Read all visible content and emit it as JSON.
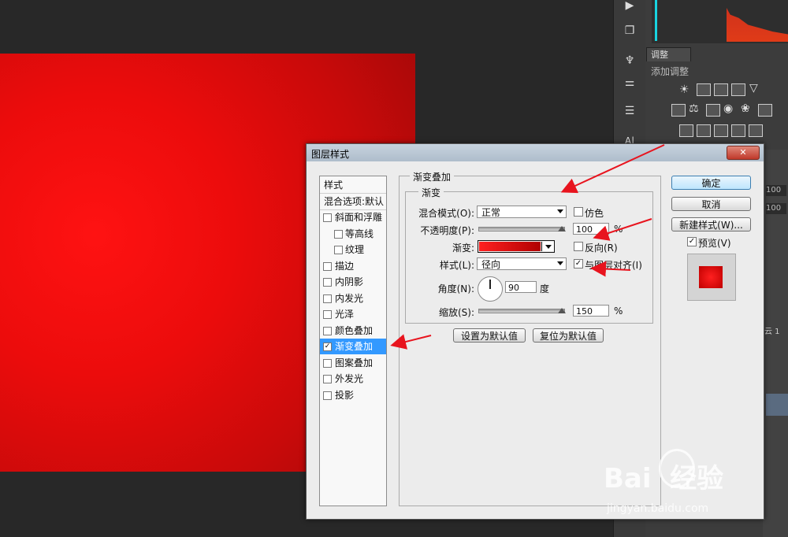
{
  "panel": {
    "adjust_tab": "调整",
    "add_adjustment": "添加调整",
    "layer_opacity_value": "100",
    "layer_fill_value": "100",
    "layer_name_fragment": "云 1"
  },
  "dialog": {
    "title": "图层样式",
    "close_glyph": "✕",
    "style_list": [
      {
        "label": "样式",
        "checkbox": false,
        "checked": false,
        "selected": false,
        "indent": false
      },
      {
        "label": "混合选项:默认",
        "checkbox": false,
        "checked": false,
        "selected": false,
        "indent": false
      },
      {
        "label": "斜面和浮雕",
        "checkbox": true,
        "checked": false,
        "selected": false,
        "indent": false
      },
      {
        "label": "等高线",
        "checkbox": true,
        "checked": false,
        "selected": false,
        "indent": true
      },
      {
        "label": "纹理",
        "checkbox": true,
        "checked": false,
        "selected": false,
        "indent": true
      },
      {
        "label": "描边",
        "checkbox": true,
        "checked": false,
        "selected": false,
        "indent": false
      },
      {
        "label": "内阴影",
        "checkbox": true,
        "checked": false,
        "selected": false,
        "indent": false
      },
      {
        "label": "内发光",
        "checkbox": true,
        "checked": false,
        "selected": false,
        "indent": false
      },
      {
        "label": "光泽",
        "checkbox": true,
        "checked": false,
        "selected": false,
        "indent": false
      },
      {
        "label": "颜色叠加",
        "checkbox": true,
        "checked": false,
        "selected": false,
        "indent": false
      },
      {
        "label": "渐变叠加",
        "checkbox": true,
        "checked": true,
        "selected": true,
        "indent": false
      },
      {
        "label": "图案叠加",
        "checkbox": true,
        "checked": false,
        "selected": false,
        "indent": false
      },
      {
        "label": "外发光",
        "checkbox": true,
        "checked": false,
        "selected": false,
        "indent": false
      },
      {
        "label": "投影",
        "checkbox": true,
        "checked": false,
        "selected": false,
        "indent": false
      }
    ],
    "group_title": "渐变叠加",
    "subgroup_title": "渐变",
    "blend_mode_label": "混合模式(O):",
    "blend_mode_value": "正常",
    "dither_label": "仿色",
    "dither_checked": false,
    "opacity_label": "不透明度(P):",
    "opacity_value": "100",
    "opacity_unit": "%",
    "gradient_label": "渐变:",
    "reverse_label": "反向(R)",
    "reverse_checked": false,
    "style_label": "样式(L):",
    "style_value": "径向",
    "align_label": "与图层对齐(I)",
    "align_checked": true,
    "angle_label": "角度(N):",
    "angle_value": "90",
    "angle_unit": "度",
    "scale_label": "缩放(S):",
    "scale_value": "150",
    "scale_unit": "%",
    "set_default_btn": "设置为默认值",
    "reset_default_btn": "复位为默认值",
    "ok_btn": "确定",
    "cancel_btn": "取消",
    "new_style_btn": "新建样式(W)...",
    "preview_label": "预览(V)",
    "preview_checked": true
  },
  "watermark": {
    "brand": "Bai  经验",
    "url": "jingyan.baidu.com"
  },
  "colors": {
    "canvas_red": "#ee0c0c",
    "selection_blue": "#3399ff",
    "arrow_red": "#e8141e"
  },
  "icons": [
    "play-icon",
    "layers-icon",
    "brush-icon",
    "sliders-icon",
    "info-icon",
    "text-icon"
  ]
}
